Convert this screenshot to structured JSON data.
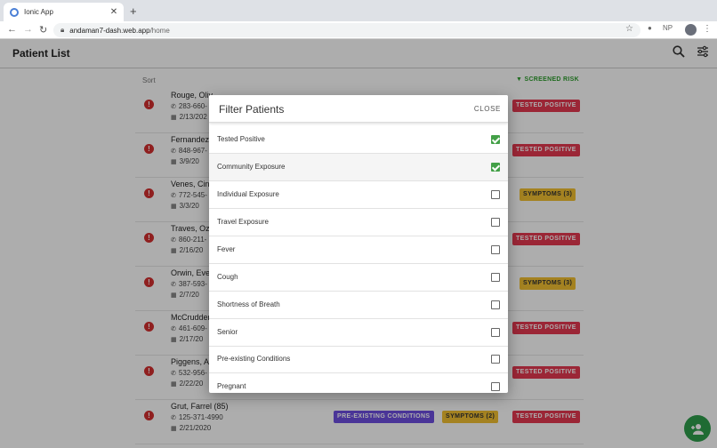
{
  "browser": {
    "tab_title": "Ionic App",
    "url_host": "andaman7-dash.web.app",
    "url_path": "/home"
  },
  "app": {
    "title": "Patient List",
    "sort_label": "Sort",
    "screened_label": "SCREENED RISK"
  },
  "patients": [
    {
      "name": "Rouge, Oliv",
      "phone": "283-660-",
      "date": "2/13/202"
    },
    {
      "name": "Fernandez,",
      "phone": "848-967-",
      "date": "3/9/20"
    },
    {
      "name": "Venes, Cinc",
      "phone": "772-545-",
      "date": "3/3/20"
    },
    {
      "name": "Traves, Ozz",
      "phone": "860-211-",
      "date": "2/16/20"
    },
    {
      "name": "Orwin, Evel",
      "phone": "387-593-",
      "date": "2/7/20"
    },
    {
      "name": "McCrudden",
      "phone": "461-609-",
      "date": "2/17/20"
    },
    {
      "name": "Piggens, Ar",
      "phone": "532-956-",
      "date": "2/22/20"
    },
    {
      "name": "Grut, Farrel (85)",
      "phone": "125-371-4990",
      "date": "2/21/2020"
    }
  ],
  "badges": {
    "tested_positive": "TESTED POSITIVE",
    "symptoms_3": "SYMPTOMS (3)",
    "symptoms_2": "SYMPTOMS (2)",
    "pre_existing": "PRE-EXISTING CONDITIONS"
  },
  "filter": {
    "title": "Filter Patients",
    "close_label": "CLOSE",
    "options": [
      {
        "label": "Tested Positive",
        "checked": true
      },
      {
        "label": "Community Exposure",
        "checked": true
      },
      {
        "label": "Individual Exposure",
        "checked": false
      },
      {
        "label": "Travel Exposure",
        "checked": false
      },
      {
        "label": "Fever",
        "checked": false
      },
      {
        "label": "Cough",
        "checked": false
      },
      {
        "label": "Shortness of Breath",
        "checked": false
      },
      {
        "label": "Senior",
        "checked": false
      },
      {
        "label": "Pre-existing Conditions",
        "checked": false
      },
      {
        "label": "Pregnant",
        "checked": false
      }
    ]
  },
  "colors": {
    "positive": "#e53950",
    "symptoms": "#f2c032",
    "pre_existing": "#6d4ee0",
    "checkbox_checked": "#43a047",
    "fab": "#2e9e4c"
  },
  "icons": [
    "search-icon",
    "filter-settings-icon",
    "add-person-icon",
    "alert-icon",
    "phone-icon",
    "calendar-icon"
  ]
}
